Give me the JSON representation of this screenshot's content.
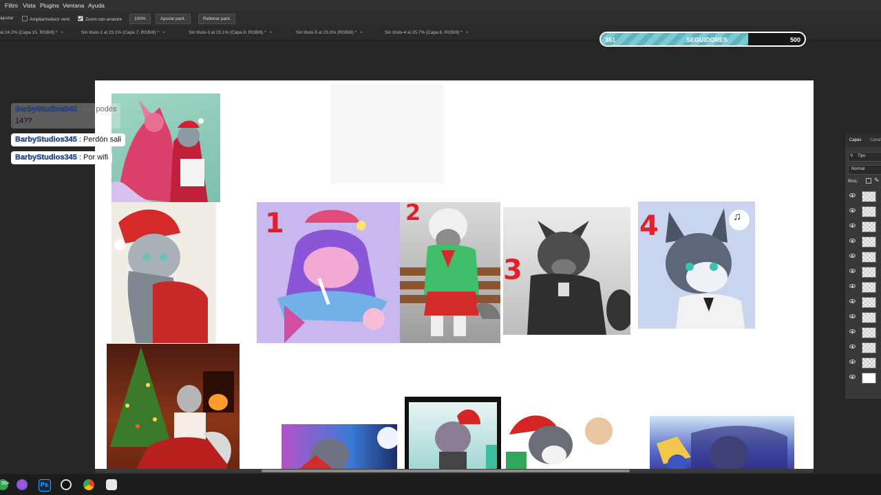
{
  "menu": [
    "Filtro",
    "Vista",
    "Plugins",
    "Ventana",
    "Ayuda"
  ],
  "options": {
    "adjust_label": "ajustar",
    "resize_windows_label": "Ampliar/reducir vent.",
    "scrubby_zoom_label": "Zoom con arrastre",
    "zoom_value": "100%",
    "fit_screen_button": "Ajustar pant.",
    "fill_screen_button": "Rellenar pant."
  },
  "tabs": [
    "al 24.2% (Capa 15, RGB/8) *",
    "Sin título-1 al 23.1% (Capa 7, RGB/8) *",
    "Sin título-3 al 23.1% (Capa 8, RGB/8) *",
    "Sin título-5 al 23.3% (RGB/8) *",
    "Sin título-4 al 25.7% (Capa 6, RGB/8) *"
  ],
  "followers": {
    "current": "361",
    "label": "SEGUIDORES",
    "goal": "500",
    "progress_fraction": 0.722,
    "bar_color": "#6cc0cb"
  },
  "chat": [
    {
      "user": "BarbyStudios345",
      "message": ": Me podés",
      "extra": "14??"
    },
    {
      "user": "BarbyStudios345",
      "message": ": Perdón sali"
    },
    {
      "user": "BarbyStudios345",
      "message": ": Por wifi"
    }
  ],
  "canvas": {
    "numbers": [
      "1",
      "2",
      "3",
      "4"
    ]
  },
  "layers_panel": {
    "tab_layers": "Capas",
    "tab_channels": "Canal",
    "filter_label": "Tipo",
    "blend_mode": "Normal",
    "lock_label": "Bloq.:",
    "rows": 13
  },
  "taskbar": {
    "badge": "99+",
    "ps_label": "Ps"
  }
}
